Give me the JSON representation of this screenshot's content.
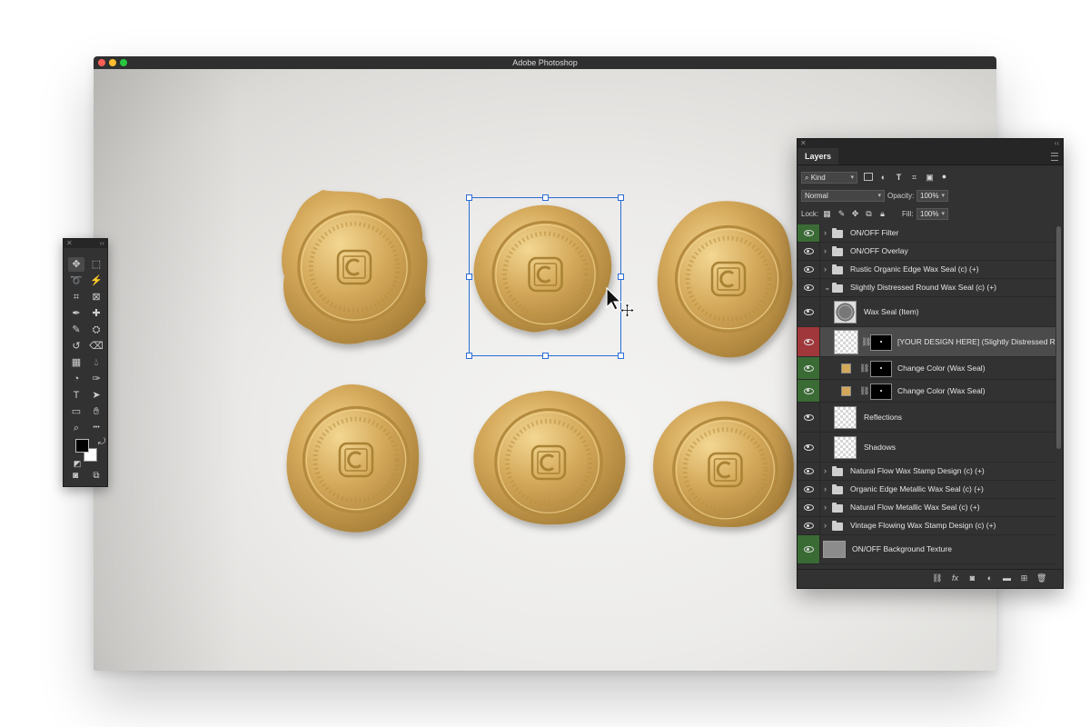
{
  "window": {
    "title": "Adobe Photoshop"
  },
  "tools": {
    "items": [
      "move-tool",
      "marquee-tool",
      "lasso-tool",
      "magic-wand-tool",
      "crop-tool",
      "frame-tool",
      "eyedropper-tool",
      "healing-brush-tool",
      "brush-tool",
      "clone-stamp-tool",
      "history-brush-tool",
      "eraser-tool",
      "gradient-tool",
      "blur-tool",
      "dodge-tool",
      "pen-tool",
      "type-tool",
      "path-selection-tool",
      "rectangle-tool",
      "hand-tool",
      "zoom-tool",
      "more-tools"
    ],
    "foreground_color": "#000000",
    "background_color": "#ffffff"
  },
  "seal_color": "#d4a85a",
  "layers_panel": {
    "tab_label": "Layers",
    "filter_kind": "Kind",
    "blend_mode": "Normal",
    "opacity_label": "Opacity:",
    "opacity_value": "100%",
    "lock_label": "Lock:",
    "fill_label": "Fill:",
    "fill_value": "100%",
    "layers": [
      {
        "name": "ON/OFF Filter"
      },
      {
        "name": "ON/OFF Overlay"
      },
      {
        "name": "Rustic Organic Edge Wax Seal (c) (+)"
      },
      {
        "name": "Slightly Distressed Round Wax Seal (c) (+)"
      },
      {
        "name": "Wax Seal (Item)"
      },
      {
        "name": "[YOUR DESIGN HERE] (Slightly Distressed Ro"
      },
      {
        "name": "Change Color (Wax Seal)"
      },
      {
        "name": "Change Color (Wax Seal)"
      },
      {
        "name": "Reflections"
      },
      {
        "name": "Shadows"
      },
      {
        "name": "Natural Flow Wax Stamp Design (c) (+)"
      },
      {
        "name": "Organic Edge Metallic Wax Seal (c) (+)"
      },
      {
        "name": "Natural Flow Metallic Wax Seal (c) (+)"
      },
      {
        "name": "Vintage Flowing Wax Stamp Design (c) (+)"
      },
      {
        "name": "ON/OFF Background Texture"
      }
    ]
  }
}
